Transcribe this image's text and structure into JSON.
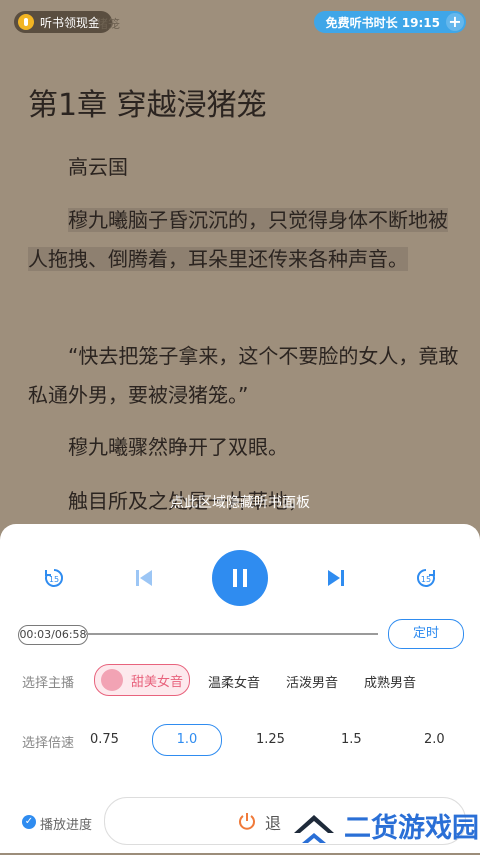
{
  "header": {
    "reward_pill": "听书领现金",
    "faded_text": "猪笼",
    "free_time": "免费听书时长 19:15",
    "plus": "+"
  },
  "reader": {
    "chapter_title": "第1章  穿越浸猪笼",
    "paragraphs": [
      "高云国",
      "穆九曦脑子昏沉沉的，只觉得身体不断地被人拖拽、倒腾着，耳朵里还传来各种声音。",
      "“快去把笼子拿来，这个不要脸的女人，竟敢私通外男，要被浸猪笼。”",
      "穆九曦骤然睁开了双眼。",
      "触目所及之处是一片草地，"
    ]
  },
  "tap_hint": "点此区域隐藏听书面板",
  "player": {
    "time": "00:03/06:58",
    "timer_label": "定时",
    "anchor_label": "选择主播",
    "voices": [
      "甜美女音",
      "温柔女音",
      "活泼男音",
      "成熟男音"
    ],
    "speed_label": "选择倍速",
    "speeds": [
      "0.75",
      "1.0",
      "1.25",
      "1.5",
      "2.0"
    ],
    "progress_label": "播放进度",
    "exit_label": "退"
  },
  "watermark": "二货游戏园",
  "colors": {
    "accent": "#2f8cf0",
    "voice_accent": "#e8637d",
    "reader_bg": "#9e8f7c"
  }
}
